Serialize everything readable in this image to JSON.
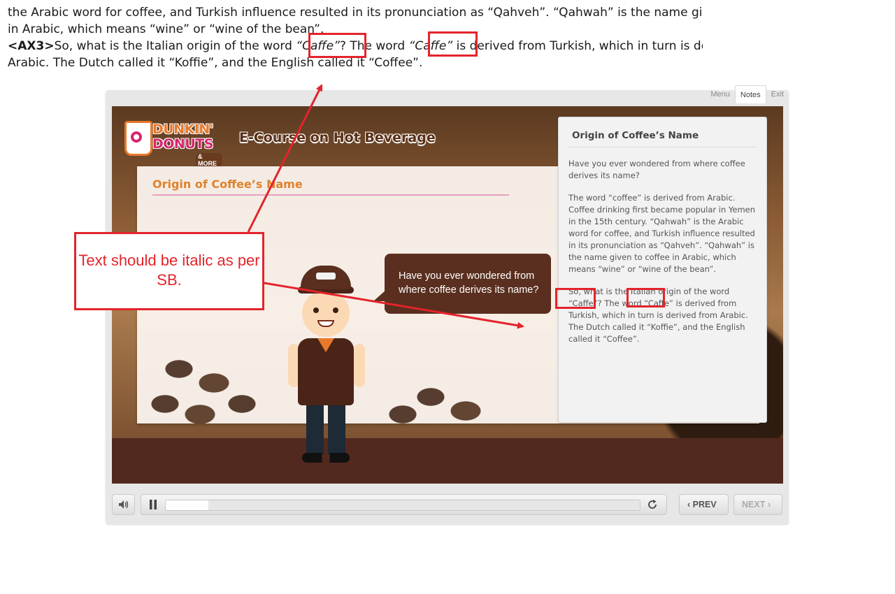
{
  "document": {
    "line1": "the Arabic word for coffee, and Turkish influence resulted in its pronunciation as “Qahveh”. “Qahwah” is the name given to coffee",
    "line2": "in Arabic, which means “wine” or “wine of the bean”.",
    "line3": {
      "tag": "<AX3>",
      "before": "So, what is the Italian origin of the word ",
      "word1": "“Caffe”",
      "middle": "? The word ",
      "word2": "“Caffe”",
      "after": " is derived from Turkish, which in turn is derived from"
    },
    "line4": "Arabic. The Dutch called it “Koffie”, and the English called it “Coffee”."
  },
  "player": {
    "tabs": [
      "Menu",
      "Notes",
      "Exit"
    ],
    "active_tab": "Notes",
    "logo": {
      "word1": "DUNKIN'",
      "word2": "DONUTS",
      "tagline": "& MORE"
    },
    "course_title": "E-Course on Hot Beverage",
    "slide_heading": "Origin of Coffee’s Name",
    "speech_bubble": "Have you ever wondered from where coffee derives its name?",
    "notes": {
      "title": "Origin of Coffee’s Name",
      "paragraphs": [
        "Have you ever wondered from where coffee derives its name?",
        "The word “coffee” is derived from Arabic. Coffee drinking first became popular in Yemen in the 15th century. “Qahwah” is the Arabic word for coffee, and Turkish influence resulted in its pronunciation as “Qahveh”. “Qahwah” is the name given to coffee in Arabic, which means “wine” or “wine of the bean”.",
        "So, what is the Italian origin of the word “Caffe”? The word “Caffe” is derived from Turkish, which in turn is derived from Arabic. The Dutch called it “Koffie”, and the English called it “Coffee”."
      ]
    },
    "controls": {
      "volume_icon": "speaker-icon",
      "pause_icon": "pause-icon",
      "replay_icon": "replay-icon",
      "progress": 0.09,
      "prev_label": "PREV",
      "next_label": "NEXT"
    }
  },
  "annotation": {
    "callout_text": "Text should be italic as per SB.",
    "color": "#e3242b"
  }
}
